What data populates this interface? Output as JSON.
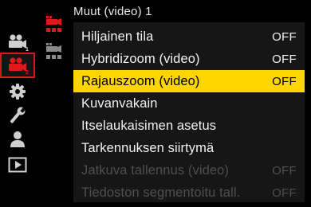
{
  "header": {
    "submenu_title": "Muut (video) 1"
  },
  "tabs": [
    {
      "icon": "video-camera-1-icon",
      "badge": "1",
      "active": false
    },
    {
      "icon": "video-camera-2-icon",
      "badge": "2",
      "active": true
    },
    {
      "icon": "gear-icon",
      "active": false
    },
    {
      "icon": "wrench-icon",
      "active": false
    },
    {
      "icon": "person-icon",
      "active": false
    },
    {
      "icon": "playback-icon",
      "active": false
    }
  ],
  "subpages": [
    {
      "icon": "subpage-1-icon",
      "active": true
    },
    {
      "icon": "subpage-2-icon",
      "active": false
    }
  ],
  "colors": {
    "accent_red": "#d11a1a",
    "selection_yellow": "#fdd500",
    "disabled_gray": "#4f4f4f"
  },
  "menu": {
    "items": [
      {
        "label": "Hiljainen tila",
        "value": "OFF",
        "state": "normal"
      },
      {
        "label": "Hybridizoom (video)",
        "value": "OFF",
        "state": "normal"
      },
      {
        "label": "Rajauszoom (video)",
        "value": "OFF",
        "state": "selected"
      },
      {
        "label": "Kuvanvakain",
        "value": "",
        "state": "normal"
      },
      {
        "label": "Itselaukaisimen asetus",
        "value": "",
        "state": "normal"
      },
      {
        "label": "Tarkennuksen siirtymä",
        "value": "",
        "state": "normal"
      },
      {
        "label": "Jatkuva tallennus (video)",
        "value": "OFF",
        "state": "disabled"
      },
      {
        "label": "Tiedoston segmentoitu tall.",
        "value": "OFF",
        "state": "disabled"
      }
    ]
  }
}
